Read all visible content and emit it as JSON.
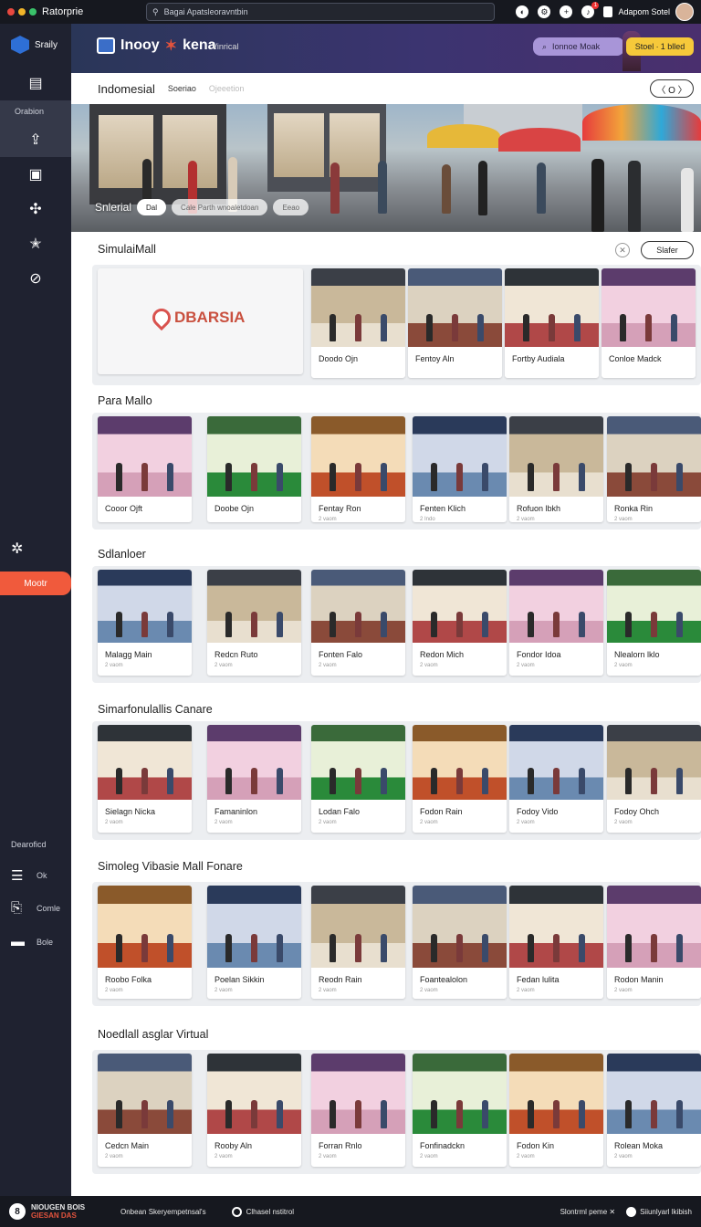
{
  "topbar": {
    "title": "Ratorprie",
    "url_placeholder": "Bagai Apatsleoravntbin",
    "user_name": "Adapom Sotel",
    "notification_count": "1",
    "window_dot_colors": [
      "#e8483f",
      "#f0b429",
      "#3ac26a"
    ]
  },
  "sidebar": {
    "brand": "Sraily",
    "section_label": "Orabion",
    "new_button": "Mootr",
    "bottom_label": "Dearoficd",
    "bottom_items": [
      {
        "icon": "list-icon",
        "label": "Ok"
      },
      {
        "icon": "clipboard-icon",
        "label": "Comle"
      },
      {
        "icon": "box-icon",
        "label": "Bole"
      }
    ]
  },
  "hero": {
    "logo_left": "Inooy",
    "logo_right": "kena",
    "subtitle": "Vinrical",
    "search_label": "Ionnoe Moak",
    "badge_label": "Stoel ∙ 1 blled"
  },
  "breadcrumb": {
    "title": "Indomesial",
    "tab_active": "Soeriao",
    "tab_inactive": "Ojeeetion",
    "control": "〈 O 〉"
  },
  "banner": {
    "label": "Snlerial",
    "chip_1": "Dal",
    "chip_2": "Cale Parth wnoaletdoan",
    "chip_3": "Eeao"
  },
  "sections": [
    {
      "title": "SimulaiMall",
      "filter_label": "Slafer",
      "feature_brand": "DBARSIA",
      "cards": [
        {
          "caption": "Doodo Ojn",
          "sub": ""
        },
        {
          "caption": "Fentoy Aln",
          "sub": ""
        },
        {
          "caption": "Fortby Audiala",
          "sub": ""
        },
        {
          "caption": "Conloe Madck",
          "sub": ""
        }
      ]
    },
    {
      "title": "Para Mallo",
      "cards": [
        {
          "caption": "Cooor Ojft",
          "sub": ""
        },
        {
          "caption": "Doobe Ojn",
          "sub": ""
        },
        {
          "caption": "Fentay Ron",
          "sub": "2 vaom"
        },
        {
          "caption": "Fenten Klich",
          "sub": "2 Indo"
        },
        {
          "caption": "Rofuon lbkh",
          "sub": "2 vaom"
        },
        {
          "caption": "Ronka Rin",
          "sub": "2 vaom"
        }
      ]
    },
    {
      "title": "Sdlanloer",
      "cards": [
        {
          "caption": "Malagg Main",
          "sub": "2 vaom"
        },
        {
          "caption": "Redcn Ruto",
          "sub": "2 vaom"
        },
        {
          "caption": "Fonten Falo",
          "sub": "2 vaom"
        },
        {
          "caption": "Redon Mich",
          "sub": "2 vaom"
        },
        {
          "caption": "Fondor Idoa",
          "sub": "2 vaom"
        },
        {
          "caption": "Nlealorn lklo",
          "sub": "2 vaom"
        }
      ]
    },
    {
      "title": "Simarfonulallis Canare",
      "cards": [
        {
          "caption": "Sielagn Nicka",
          "sub": "2 vaom"
        },
        {
          "caption": "Famaninlon",
          "sub": "2 vaom"
        },
        {
          "caption": "Lodan Falo",
          "sub": "2 vaom"
        },
        {
          "caption": "Fodon Rain",
          "sub": "2 vaom"
        },
        {
          "caption": "Fodoy Vido",
          "sub": "2 vaom"
        },
        {
          "caption": "Fodoy Ohch",
          "sub": "2 vaom"
        }
      ]
    },
    {
      "title": "Simoleg Vibasie Mall Fonare",
      "cards": [
        {
          "caption": "Roobo Folka",
          "sub": "2 vaom"
        },
        {
          "caption": "Poelan Sikkin",
          "sub": "2 vaom"
        },
        {
          "caption": "Reodn Rain",
          "sub": "2 vaom"
        },
        {
          "caption": "Foantealolon",
          "sub": "2 vaom"
        },
        {
          "caption": "Fedan lulita",
          "sub": "2 vaom"
        },
        {
          "caption": "Rodon Manin",
          "sub": "2 vaom"
        }
      ]
    },
    {
      "title": "Noedlall asglar Virtual",
      "cards": [
        {
          "caption": "Cedcn Main",
          "sub": "2 vaom"
        },
        {
          "caption": "Rooby Aln",
          "sub": "2 vaom"
        },
        {
          "caption": "Forran Rnlo",
          "sub": "2 vaom"
        },
        {
          "caption": "Fonfinadckn",
          "sub": "2 vaom"
        },
        {
          "caption": "Fodon Kin",
          "sub": "2 vaom"
        },
        {
          "caption": "Rolean Moka",
          "sub": "2 vaom"
        }
      ]
    }
  ],
  "footer": {
    "brand_line1": "NIOUGEN BOIS",
    "brand_line2": "GIESAN DAS",
    "link_1": "Onbean Skeryempetnsal's",
    "link_2": "Clhasel nstitrol",
    "right_1": "Slontrml peme ✕",
    "right_2": "Siiunlyarl lkibish"
  },
  "colors": {
    "accent_orange": "#f05a3c",
    "sidebar_bg": "#1f2230",
    "badge_yellow": "#f6c93a",
    "search_purple": "#a895d8"
  }
}
